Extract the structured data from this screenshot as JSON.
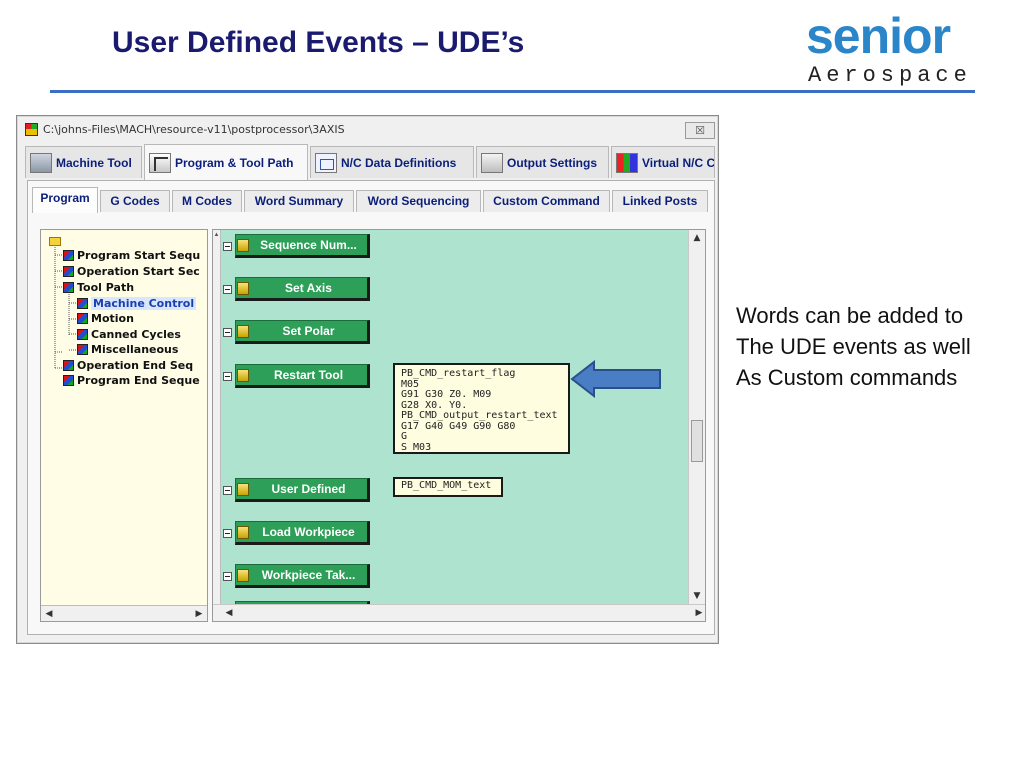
{
  "slide": {
    "title": "User Defined Events – UDE’s"
  },
  "logo": {
    "word": "senior",
    "sub": "Aerospace"
  },
  "window": {
    "title": "C:\\johns-Files\\MACH\\resource-v11\\postprocessor\\3AXIS",
    "close_label": "☒"
  },
  "main_tabs": [
    {
      "label": "Machine Tool",
      "icon": "machine-tool-icon"
    },
    {
      "label": "Program & Tool Path",
      "icon": "tool-path-icon",
      "active": true
    },
    {
      "label": "N/C Data Definitions",
      "icon": "nc-data-icon"
    },
    {
      "label": "Output Settings",
      "icon": "output-settings-icon"
    },
    {
      "label": "Virtual N/C C",
      "icon": "virtual-nc-icon"
    }
  ],
  "sub_tabs": [
    {
      "label": "Program",
      "active": true
    },
    {
      "label": "G Codes"
    },
    {
      "label": "M Codes"
    },
    {
      "label": "Word Summary"
    },
    {
      "label": "Word Sequencing"
    },
    {
      "label": "Custom Command"
    },
    {
      "label": "Linked Posts"
    }
  ],
  "tree": {
    "items": [
      {
        "label": "Program Start Sequ"
      },
      {
        "label": "Operation Start Sec"
      },
      {
        "label": "Tool Path"
      },
      {
        "label": "Machine Control",
        "selected": true
      },
      {
        "label": "Motion"
      },
      {
        "label": "Canned Cycles"
      },
      {
        "label": "Miscellaneous"
      },
      {
        "label": "Operation End Seq"
      },
      {
        "label": "Program End Seque"
      }
    ]
  },
  "events": [
    {
      "label": "Sequence Num..."
    },
    {
      "label": "Set Axis"
    },
    {
      "label": "Set Polar"
    },
    {
      "label": "Restart Tool"
    },
    {
      "label": "User Defined"
    },
    {
      "label": "Load Workpiece"
    },
    {
      "label": "Workpiece Tak..."
    }
  ],
  "restart_tool_code": [
    "PB_CMD_restart_flag",
    "M05",
    "G91 G30 Z0. M09",
    "G28 X0. Y0.",
    "PB_CMD_output_restart_text",
    "G17 G40 G49 G90 G80",
    "G",
    "S M03"
  ],
  "user_defined_code": "PB_CMD_MOM_text",
  "note": {
    "lines": [
      "Words can be added to",
      "The UDE events as well",
      "As Custom commands"
    ]
  },
  "colors": {
    "title": "#1a1a6e",
    "rule": "#3a6fc4",
    "logo": "#2b86c9",
    "canvas": "#aee3cf",
    "event_button": "#2d9f58",
    "arrow": "#4a7ec4"
  }
}
